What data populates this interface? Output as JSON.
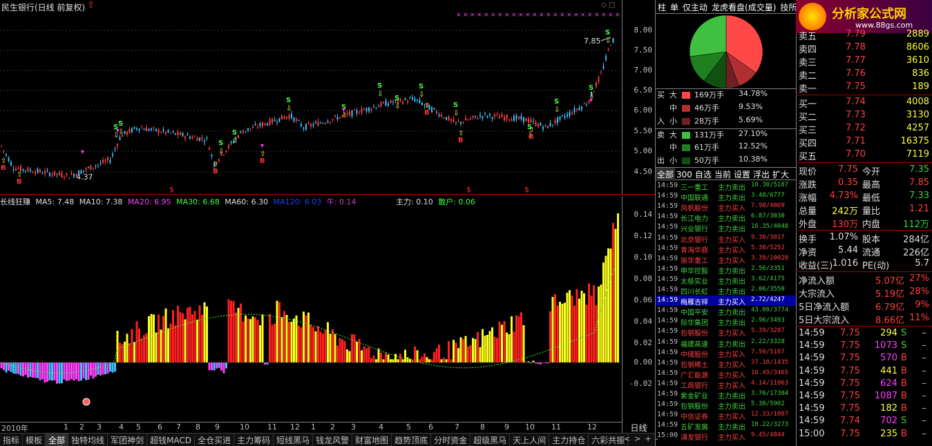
{
  "header": {
    "title": "民生银行(日线 前复权)",
    "ctrl": "◇ □"
  },
  "price_axis": [
    "8.00",
    "7.50",
    "7.00",
    "6.50",
    "6.00",
    "5.50",
    "5.00",
    "4.50"
  ],
  "price_annot": {
    "high": "7.85",
    "low": "4.37"
  },
  "markers": {
    "S": "S",
    "B": "B",
    "dollar": "$"
  },
  "ind_axis": [
    "0.14",
    "0.12",
    "0.10",
    "0.08",
    "0.06",
    "0.04",
    "0.02",
    "0.00",
    "-0.02"
  ],
  "indicator": {
    "name": "长线狂赚",
    "ma5": "MA5: 7.48",
    "ma10": "MA10: 7.38",
    "ma20": "MA20: 6.95",
    "ma30": "MA30: 6.68",
    "ma60": "MA60: 6.30",
    "ma120": "MA120: 6.03",
    "niu": "牛: 0.14",
    "zhuli": "主力: 0.10",
    "sanhu": "散户: 0.06"
  },
  "dates": [
    "2010年",
    "1",
    "2",
    "3",
    "4",
    "5",
    "6",
    "7",
    "8",
    "9",
    "10",
    "11",
    "12",
    "1",
    "2",
    "3",
    "4",
    "5",
    "6",
    "7",
    "8",
    "9",
    "10",
    "11",
    "12"
  ],
  "period": "日线",
  "tabs": [
    "指标",
    "模板",
    "全部",
    "独特均线",
    "军团神剑",
    "超钱MACD",
    "全仓买进",
    "主力筹码",
    "短线黑马",
    "钱龙风警",
    "财富地图",
    "趋势顶底",
    "分时资金",
    "超级黑马",
    "天上人间",
    "主力持仓",
    "六彩共振"
  ],
  "tab_controls": [
    "<",
    ">",
    "+",
    "-"
  ],
  "mid_tabs": [
    "柱",
    "单",
    "仅主动",
    "龙虎看盘(成交量)",
    "技所有"
  ],
  "flow": {
    "buy_label": [
      "买",
      "入"
    ],
    "sell_label": [
      "卖",
      "出"
    ],
    "rows": [
      {
        "side": "买",
        "size": "大",
        "vol": "169万手",
        "pct": "34.78%",
        "color": "#ff4848"
      },
      {
        "side": "",
        "size": "中",
        "vol": "46万手",
        "pct": "9.53%",
        "color": "#b03030"
      },
      {
        "side": "入",
        "size": "小",
        "vol": "28万手",
        "pct": "5.69%",
        "color": "#702020"
      },
      {
        "side": "卖",
        "size": "大",
        "vol": "131万手",
        "pct": "27.10%",
        "color": "#40c040"
      },
      {
        "side": "",
        "size": "中",
        "vol": "61万手",
        "pct": "12.52%",
        "color": "#208020"
      },
      {
        "side": "出",
        "size": "小",
        "vol": "50万手",
        "pct": "10.38%",
        "color": "#105010"
      }
    ]
  },
  "sub_tabs": [
    "全部",
    "300",
    "自选",
    "当前",
    "设置",
    "浮出",
    "扩大"
  ],
  "ticks": [
    {
      "t": "14:59",
      "name": "三一重工",
      "act": "主力卖出",
      "val": "10.30/5187",
      "c": "#40d040"
    },
    {
      "t": "14:59",
      "name": "中国联通",
      "act": "主力卖出",
      "val": "3.48/6777",
      "c": "#40d040"
    },
    {
      "t": "14:59",
      "name": "风帆股份",
      "act": "主力买入",
      "val": "7.98/4069",
      "c": "#ff4040"
    },
    {
      "t": "14:59",
      "name": "长江电力",
      "act": "主力卖出",
      "val": "6.87/3030",
      "c": "#40d040"
    },
    {
      "t": "14:59",
      "name": "兴业银行",
      "act": "主力卖出",
      "val": "16.35/4048",
      "c": "#40d040"
    },
    {
      "t": "14:59",
      "name": "北京银行",
      "act": "主力买入",
      "val": "9.30/3017",
      "c": "#ff4040"
    },
    {
      "t": "14:59",
      "name": "青海华鼎",
      "act": "主力买入",
      "val": "5.30/5252",
      "c": "#ff4040"
    },
    {
      "t": "14:59",
      "name": "振华重工",
      "act": "主力买入",
      "val": "3.39/10020",
      "c": "#ff4040"
    },
    {
      "t": "14:59",
      "name": "申华控股",
      "act": "主力卖出",
      "val": "2.56/3351",
      "c": "#40d040"
    },
    {
      "t": "14:59",
      "name": "太极实业",
      "act": "主力卖出",
      "val": "3.62/4175",
      "c": "#40d040"
    },
    {
      "t": "14:59",
      "name": "四川长虹",
      "act": "主力卖出",
      "val": "2.06/3550",
      "c": "#40d040"
    },
    {
      "t": "14:59",
      "name": "梅雁吉祥",
      "act": "主力买入",
      "val": "2.72/4247",
      "c": "#4040ff",
      "hl": true
    },
    {
      "t": "14:59",
      "name": "中国平安",
      "act": "主力卖出",
      "val": "43.00/3774",
      "c": "#40d040"
    },
    {
      "t": "14:59",
      "name": "际华集团",
      "act": "主力卖出",
      "val": "2.96/3493",
      "c": "#40d040"
    },
    {
      "t": "14:59",
      "name": "包钢股份",
      "act": "主力买入",
      "val": "5.39/3287",
      "c": "#ff4040"
    },
    {
      "t": "14:59",
      "name": "福建高速",
      "act": "主力卖出",
      "val": "2.22/3328",
      "c": "#40d040"
    },
    {
      "t": "14:59",
      "name": "中储股份",
      "act": "主力买入",
      "val": "7.50/5107",
      "c": "#ff4040"
    },
    {
      "t": "14:59",
      "name": "包钢稀土",
      "act": "主力买入",
      "val": "37.18/1435",
      "c": "#ff4040"
    },
    {
      "t": "14:59",
      "name": "广汇能源",
      "act": "主力买入",
      "val": "16.49/3465",
      "c": "#ff4040"
    },
    {
      "t": "14:59",
      "name": "工商银行",
      "act": "主力买入",
      "val": "4.14/11063",
      "c": "#ff4040"
    },
    {
      "t": "14:59",
      "name": "紫金矿业",
      "act": "主力卖出",
      "val": "3.76/17304",
      "c": "#40d040"
    },
    {
      "t": "14:59",
      "name": "包钢股份",
      "act": "主力卖出",
      "val": "5.38/5902",
      "c": "#40d040"
    },
    {
      "t": "14:59",
      "name": "中信证券",
      "act": "主力买入",
      "val": "12.33/1007",
      "c": "#ff4040"
    },
    {
      "t": "14:59",
      "name": "五矿发展",
      "act": "主力卖出",
      "val": "18.22/3273",
      "c": "#40d040"
    },
    {
      "t": "15:00",
      "name": "浦发银行",
      "act": "主力买入",
      "val": "9.45/4844",
      "c": "#ff4040"
    }
  ],
  "logo": {
    "text": "分析家公式网",
    "url": "www.88gs.com"
  },
  "asks": [
    {
      "l": "卖五",
      "p": "7.79",
      "v": "2889"
    },
    {
      "l": "卖四",
      "p": "7.78",
      "v": "8606"
    },
    {
      "l": "卖三",
      "p": "7.77",
      "v": "3610"
    },
    {
      "l": "卖二",
      "p": "7.76",
      "v": "836"
    },
    {
      "l": "卖一",
      "p": "7.75",
      "v": "189"
    }
  ],
  "bids": [
    {
      "l": "买一",
      "p": "7.74",
      "v": "4008"
    },
    {
      "l": "买二",
      "p": "7.73",
      "v": "3130"
    },
    {
      "l": "买三",
      "p": "7.72",
      "v": "4257"
    },
    {
      "l": "买四",
      "p": "7.71",
      "v": "16375"
    },
    {
      "l": "买五",
      "p": "7.70",
      "v": "7119"
    }
  ],
  "stats": [
    {
      "a": "现价",
      "av": "7.75",
      "ac": "#ff4040",
      "b": "今开",
      "bv": "7.35",
      "bc": "#40d040"
    },
    {
      "a": "涨跌",
      "av": "0.35",
      "ac": "#ff4040",
      "b": "最高",
      "bv": "7.85",
      "bc": "#ff4040"
    },
    {
      "a": "涨幅",
      "av": "4.73%",
      "ac": "#ff4040",
      "b": "最低",
      "bv": "7.33",
      "bc": "#40d040"
    },
    {
      "a": "总量",
      "av": "242万",
      "ac": "#ffff40",
      "b": "量比",
      "bv": "1.21",
      "bc": "#ff4040"
    },
    {
      "a": "外盘",
      "av": "130万",
      "ac": "#ff4040",
      "b": "内盘",
      "bv": "112万",
      "bc": "#40d040"
    }
  ],
  "stats2": [
    {
      "a": "换手",
      "av": "1.07%",
      "ac": "#e0e0e0",
      "b": "股本",
      "bv": "284亿",
      "bc": "#e0e0e0"
    },
    {
      "a": "净资",
      "av": "5.44",
      "ac": "#e0e0e0",
      "b": "流通",
      "bv": "226亿",
      "bc": "#e0e0e0"
    },
    {
      "a": "收益(三)",
      "av": "1.016",
      "ac": "#e0e0e0",
      "b": "PE(动)",
      "bv": "5.7",
      "bc": "#e0e0e0"
    }
  ],
  "flows": [
    {
      "l": "净流入额",
      "v": "5.07亿",
      "p": "27%"
    },
    {
      "l": "大宗流入",
      "v": "5.19亿",
      "p": "28%"
    },
    {
      "l": "5日净流入额",
      "v": "6.79亿",
      "p": "9%"
    },
    {
      "l": "5日大宗流入",
      "v": "8.66亿",
      "p": "11%"
    }
  ],
  "trades": [
    {
      "t": "14:59",
      "p": "7.75",
      "v": "294",
      "d": "S",
      "dc": "#40d040",
      "vc": "#ffff40"
    },
    {
      "t": "14:59",
      "p": "7.75",
      "v": "1073",
      "d": "S",
      "dc": "#40d040",
      "vc": "#ff40ff"
    },
    {
      "t": "14:59",
      "p": "7.75",
      "v": "570",
      "d": "B",
      "dc": "#ff4040",
      "vc": "#ff40ff"
    },
    {
      "t": "14:59",
      "p": "7.75",
      "v": "441",
      "d": "B",
      "dc": "#ff4040",
      "vc": "#ffff40"
    },
    {
      "t": "14:59",
      "p": "7.75",
      "v": "624",
      "d": "B",
      "dc": "#ff4040",
      "vc": "#ff40ff"
    },
    {
      "t": "14:59",
      "p": "7.75",
      "v": "1087",
      "d": "B",
      "dc": "#ff4040",
      "vc": "#ff40ff"
    },
    {
      "t": "14:59",
      "p": "7.75",
      "v": "182",
      "d": "B",
      "dc": "#ff4040",
      "vc": "#ffff40"
    },
    {
      "t": "14:59",
      "p": "7.74",
      "v": "702",
      "d": "S",
      "dc": "#40d040",
      "vc": "#ff40ff"
    },
    {
      "t": "15:00",
      "p": "7.75",
      "v": "235",
      "d": "B",
      "dc": "#ff4040",
      "vc": "#ffff40"
    }
  ],
  "trade_dash": "–"
}
